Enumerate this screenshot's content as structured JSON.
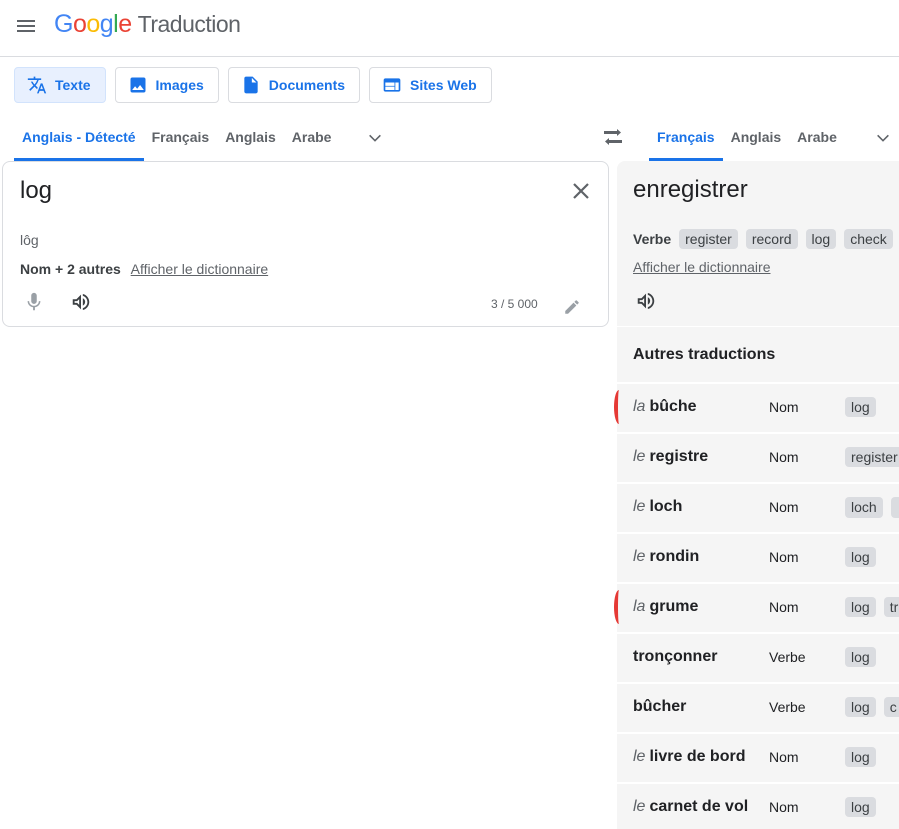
{
  "header": {
    "logo_letters": [
      "G",
      "o",
      "o",
      "g",
      "l",
      "e"
    ],
    "product": "Traduction"
  },
  "modes": [
    {
      "label": "Texte",
      "icon": "translate-icon"
    },
    {
      "label": "Images",
      "icon": "image-icon"
    },
    {
      "label": "Documents",
      "icon": "document-icon"
    },
    {
      "label": "Sites Web",
      "icon": "website-icon"
    }
  ],
  "source_langs": [
    "Anglais - Détecté",
    "Français",
    "Anglais",
    "Arabe"
  ],
  "target_langs": [
    "Français",
    "Anglais",
    "Arabe"
  ],
  "source": {
    "text": "log",
    "transliteration": "lôg",
    "pos_summary": "Nom + 2 autres",
    "dict_link": "Afficher le dictionnaire",
    "char_count": "3 / 5 000"
  },
  "target": {
    "text": "enregistrer",
    "pos": "Verbe",
    "chips": [
      "register",
      "record",
      "log",
      "check"
    ],
    "dict_link": "Afficher le dictionnaire"
  },
  "other_translations": {
    "title": "Autres traductions",
    "rows": [
      {
        "article": "la",
        "word": "bûche",
        "pos": "Nom",
        "chips": [
          "log"
        ],
        "marked": true
      },
      {
        "article": "le",
        "word": "registre",
        "pos": "Nom",
        "chips": [
          "register"
        ],
        "marked": false
      },
      {
        "article": "le",
        "word": "loch",
        "pos": "Nom",
        "chips": [
          "loch",
          ""
        ],
        "marked": false
      },
      {
        "article": "le",
        "word": "rondin",
        "pos": "Nom",
        "chips": [
          "log"
        ],
        "marked": false
      },
      {
        "article": "la",
        "word": "grume",
        "pos": "Nom",
        "chips": [
          "log",
          "tr"
        ],
        "marked": true
      },
      {
        "article": "",
        "word": "tronçonner",
        "pos": "Verbe",
        "chips": [
          "log"
        ],
        "marked": false
      },
      {
        "article": "",
        "word": "bûcher",
        "pos": "Verbe",
        "chips": [
          "log",
          "c"
        ],
        "marked": false
      },
      {
        "article": "le",
        "word": "livre de bord",
        "pos": "Nom",
        "chips": [
          "log"
        ],
        "marked": false
      },
      {
        "article": "le",
        "word": "carnet de vol",
        "pos": "Nom",
        "chips": [
          "log"
        ],
        "marked": false
      }
    ]
  },
  "colors": {
    "accent": "#1a73e8",
    "mark": "#e53935",
    "panel": "#f5f5f5"
  }
}
